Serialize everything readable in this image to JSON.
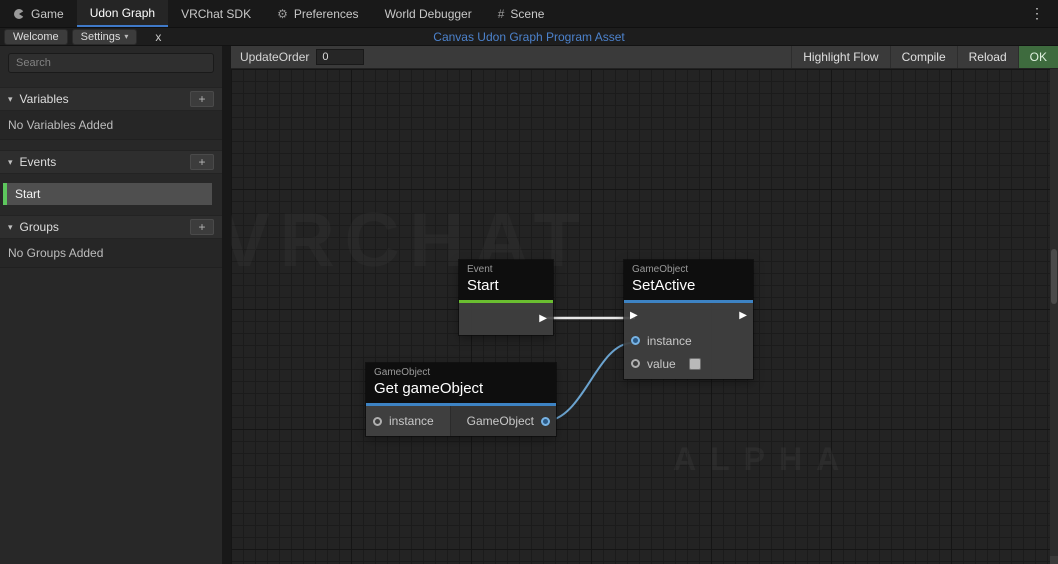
{
  "colors": {
    "event_accent": "#6abe30",
    "type_accent": "#3d83c4",
    "asset_title_blue": "#4c82cc",
    "ok_button_green": "#3e6b3e",
    "selected_event_green": "#5dc75d",
    "flow_wire": "#e8e8e8",
    "data_wire": "#6ba3cf"
  },
  "icons": {
    "gear": "⚙",
    "hash": "#",
    "more": "⋮",
    "caret": "▾",
    "foldout": "▾",
    "plus": "+",
    "flow_arrow": "▶"
  },
  "menubar": {
    "tabs": [
      {
        "label": "Game"
      },
      {
        "label": "Udon Graph"
      },
      {
        "label": "VRChat SDK"
      },
      {
        "label": "Preferences"
      },
      {
        "label": "World Debugger"
      },
      {
        "label": "Scene"
      }
    ]
  },
  "toolbar": {
    "welcome": "Welcome",
    "settings": "Settings",
    "x": "x",
    "asset_title": "Canvas Udon Graph Program Asset"
  },
  "sidebar": {
    "search_placeholder": "Search",
    "variables": {
      "label": "Variables",
      "empty": "No Variables Added"
    },
    "events": {
      "label": "Events",
      "items": [
        {
          "label": "Start"
        }
      ]
    },
    "groups": {
      "label": "Groups",
      "empty": "No Groups Added"
    }
  },
  "canvas_toolbar": {
    "update_order_label": "UpdateOrder",
    "update_order_value": "0",
    "highlight_flow": "Highlight Flow",
    "compile": "Compile",
    "reload": "Reload",
    "ok": "OK"
  },
  "graph": {
    "watermark_top": "VRCHAT",
    "watermark_bottom": "ALPHA",
    "nodes": {
      "start": {
        "category": "Event",
        "title": "Start"
      },
      "set_active": {
        "category": "GameObject",
        "title": "SetActive",
        "ports": {
          "instance": "instance",
          "value": "value"
        }
      },
      "get_gameobject": {
        "category": "GameObject",
        "title": "Get gameObject",
        "input": "instance",
        "output": "GameObject"
      }
    }
  }
}
